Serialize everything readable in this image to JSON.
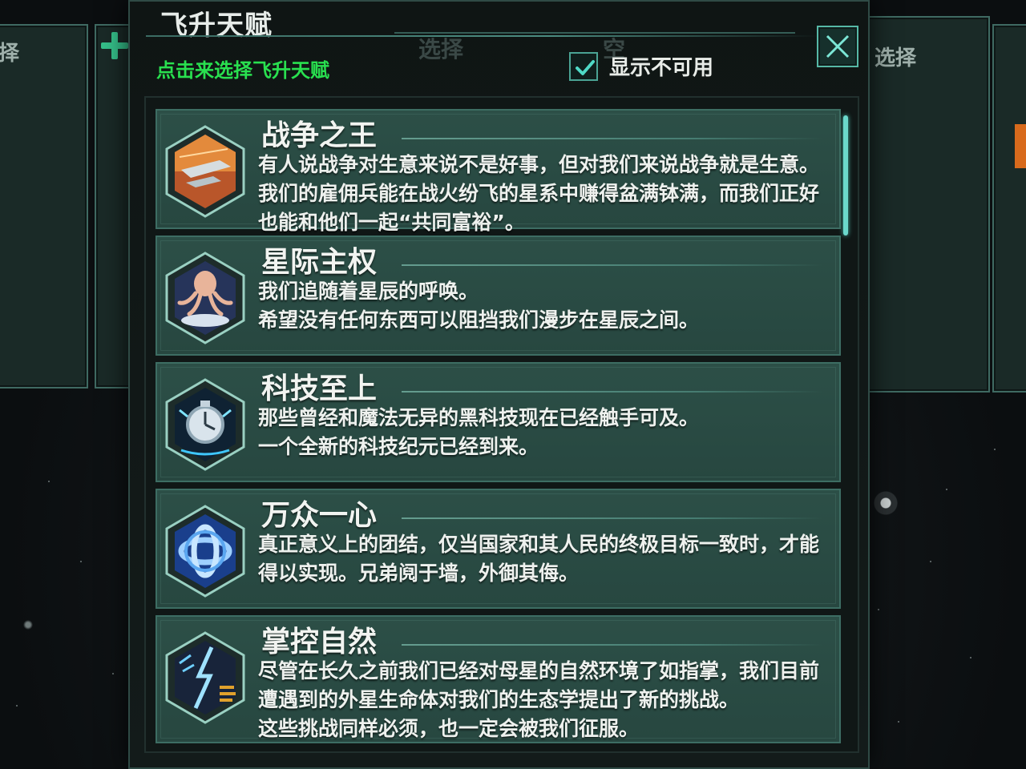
{
  "dialog": {
    "title": "飞升天赋",
    "subtitle": "点击来选择飞升天赋",
    "show_unavailable_label": "显示不可用",
    "show_unavailable_checked": true,
    "close_icon": "close-icon"
  },
  "background": {
    "left_label": "择",
    "right_label": "选择",
    "ghost_labels": [
      "选择",
      "空"
    ]
  },
  "traits": [
    {
      "name": "战争之王",
      "icon": "warships-icon",
      "description": "有人说战争对生意来说不是好事，但对我们来说战争就是生意。\n我们的雇佣兵能在战火纷飞的星系中赚得盆满钵满，而我们正好\n也能和他们一起“共同富裕”。"
    },
    {
      "name": "星际主权",
      "icon": "octopus-icon",
      "description": "我们追随着星辰的呼唤。\n希望没有任何东西可以阻挡我们漫步在星辰之间。"
    },
    {
      "name": "科技至上",
      "icon": "stopwatch-icon",
      "description": "那些曾经和魔法无异的黑科技现在已经触手可及。\n一个全新的科技纪元已经到来。"
    },
    {
      "name": "万众一心",
      "icon": "knot-icon",
      "description": "真正意义上的团结，仅当国家和其人民的终极目标一致时，才能\n得以实现。兄弟阋于墙，外御其侮。"
    },
    {
      "name": "掌控自然",
      "icon": "nature-lightning-icon",
      "description": "尽管在长久之前我们已经对母星的自然环境了如指掌，我们目前\n遭遇到的外星生命体对我们的生态学提出了新的挑战。\n这些挑战同样必须，也一定会被我们征服。"
    }
  ]
}
